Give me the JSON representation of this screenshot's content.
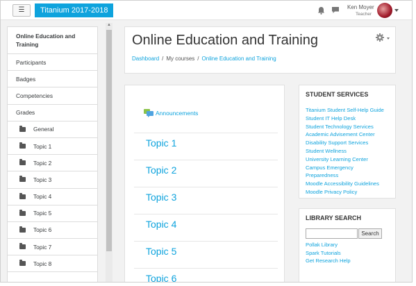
{
  "navbar": {
    "site_name": "Titanium 2017-2018",
    "user_name": "Ken Moyer",
    "user_role": "Teacher"
  },
  "drawer": {
    "items": [
      "Online Education and Training",
      "Participants",
      "Badges",
      "Competencies",
      "Grades"
    ],
    "sections": [
      "General",
      "Topic 1",
      "Topic 2",
      "Topic 3",
      "Topic 4",
      "Topic 5",
      "Topic 6",
      "Topic 7",
      "Topic 8"
    ]
  },
  "header": {
    "title": "Online Education and Training",
    "breadcrumb": {
      "dashboard": "Dashboard",
      "my_courses": "My courses",
      "course": "Online Education and Training",
      "sep": "/"
    }
  },
  "main": {
    "announcements": "Announcements",
    "topics": [
      "Topic 1",
      "Topic 2",
      "Topic 3",
      "Topic 4",
      "Topic 5",
      "Topic 6"
    ]
  },
  "student_services": {
    "title": "STUDENT SERVICES",
    "links": [
      "Titanium Student Self-Help Guide",
      "Student IT Help Desk",
      "Student Technology Services",
      "Academic Advisement Center",
      "Disability Support Services",
      "Student Wellness",
      "University Learning Center",
      "Campus Emergency",
      "Preparedness",
      "Moodle Accessibility Guidelines",
      "Moodle Privacy Policy"
    ]
  },
  "library": {
    "title": "LIBRARY SEARCH",
    "search_button": "Search",
    "search_value": "",
    "links": [
      "Pollak Library",
      "Spark Tutorials",
      "Get Research Help"
    ]
  },
  "colors": {
    "accent": "#0ea3dd",
    "background": "#f2f2f2"
  },
  "icons": [
    "hamburger-icon",
    "bell-icon",
    "message-icon",
    "folder-icon",
    "gear-icon",
    "forum-icon"
  ]
}
